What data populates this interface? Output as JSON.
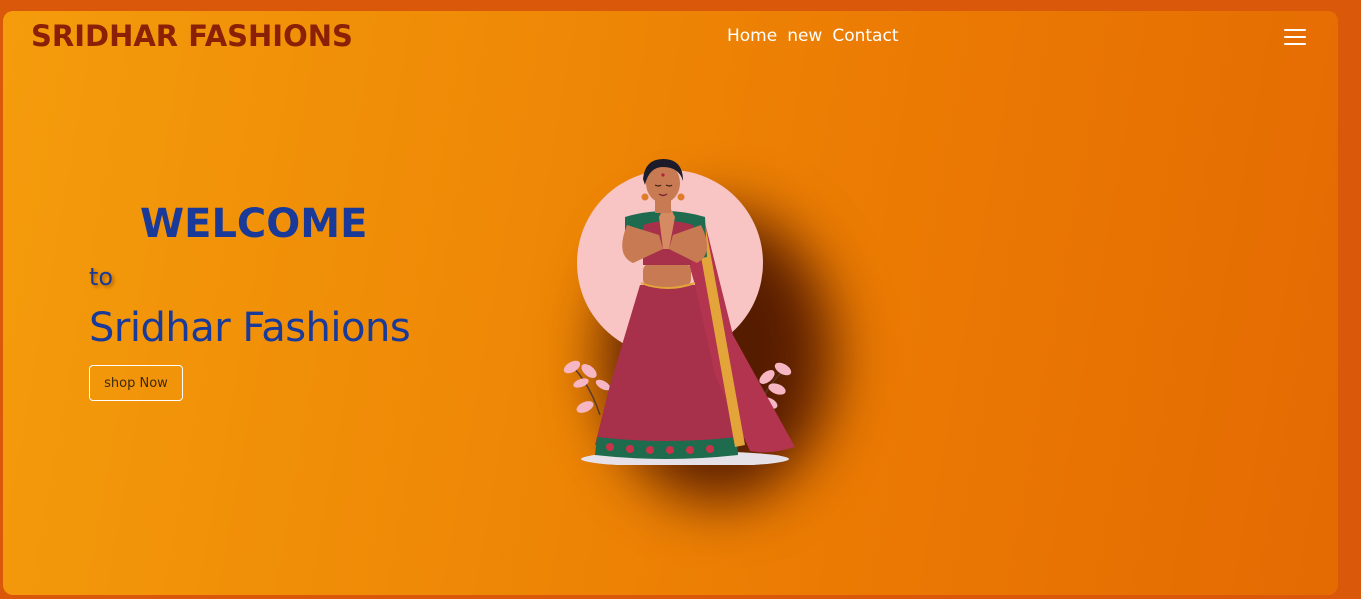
{
  "header": {
    "brand": "SRIDHAR FASHIONS",
    "nav": [
      "Home",
      "new",
      "Contact"
    ],
    "menu_icon": "hamburger-menu-icon"
  },
  "hero": {
    "welcome": "WELCOME",
    "to": "to",
    "title": "Sridhar Fashions",
    "cta": "shop Now",
    "illustration": "woman-in-saree-namaste-illustration"
  },
  "colors": {
    "background_start": "#f49c0c",
    "background_end": "#e46a02",
    "brand": "#8a2006",
    "heading": "#1a3a9a",
    "nav_text": "#ffffff"
  }
}
